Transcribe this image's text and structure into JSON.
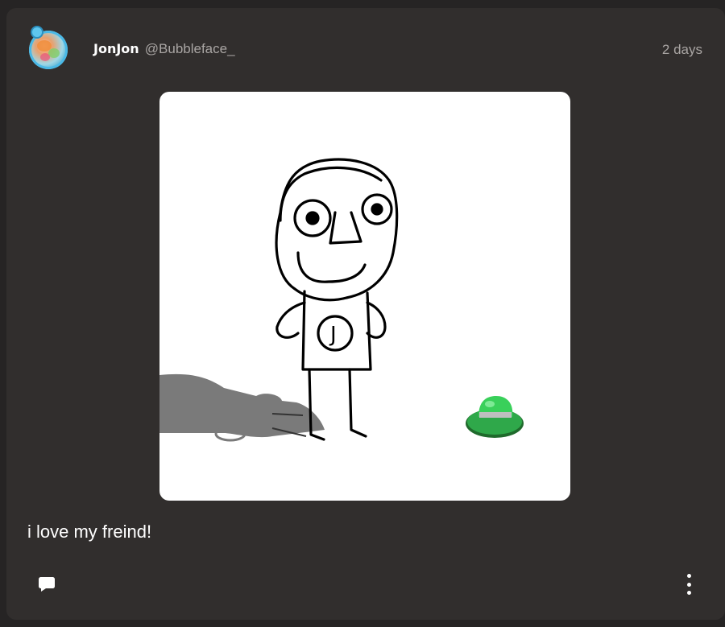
{
  "post": {
    "author": {
      "display_name": "JonJon",
      "username": "@Bubbleface_"
    },
    "timestamp": "2 days",
    "text": "i love my freind!",
    "drawing_letter": "J"
  },
  "icons": {
    "comment": "comment-icon",
    "more": "more-vertical-icon"
  }
}
